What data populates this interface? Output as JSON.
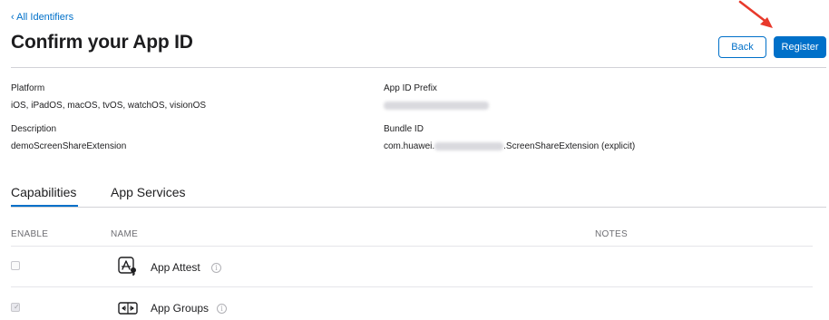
{
  "nav": {
    "back_link": "‹ All Identifiers"
  },
  "page": {
    "title": "Confirm your App ID"
  },
  "actions": {
    "back_label": "Back",
    "register_label": "Register"
  },
  "details": {
    "platform_label": "Platform",
    "platform_value": "iOS, iPadOS, macOS, tvOS, watchOS, visionOS",
    "description_label": "Description",
    "description_value": "demoScreenShareExtension",
    "prefix_label": "App ID Prefix",
    "bundle_label": "Bundle ID",
    "bundle_prefix": "com.huawei.",
    "bundle_suffix": ".ScreenShareExtension (explicit)"
  },
  "tabs": {
    "capabilities": "Capabilities",
    "app_services": "App Services"
  },
  "table": {
    "headers": {
      "enable": "ENABLE",
      "name": "NAME",
      "notes": "NOTES"
    },
    "rows": [
      {
        "name": "App Attest",
        "enabled": false,
        "icon": "app-attest-icon"
      },
      {
        "name": "App Groups",
        "enabled": true,
        "icon": "app-groups-icon"
      }
    ]
  },
  "colors": {
    "accent": "#0070c9",
    "annotation_arrow": "#e8392b"
  }
}
